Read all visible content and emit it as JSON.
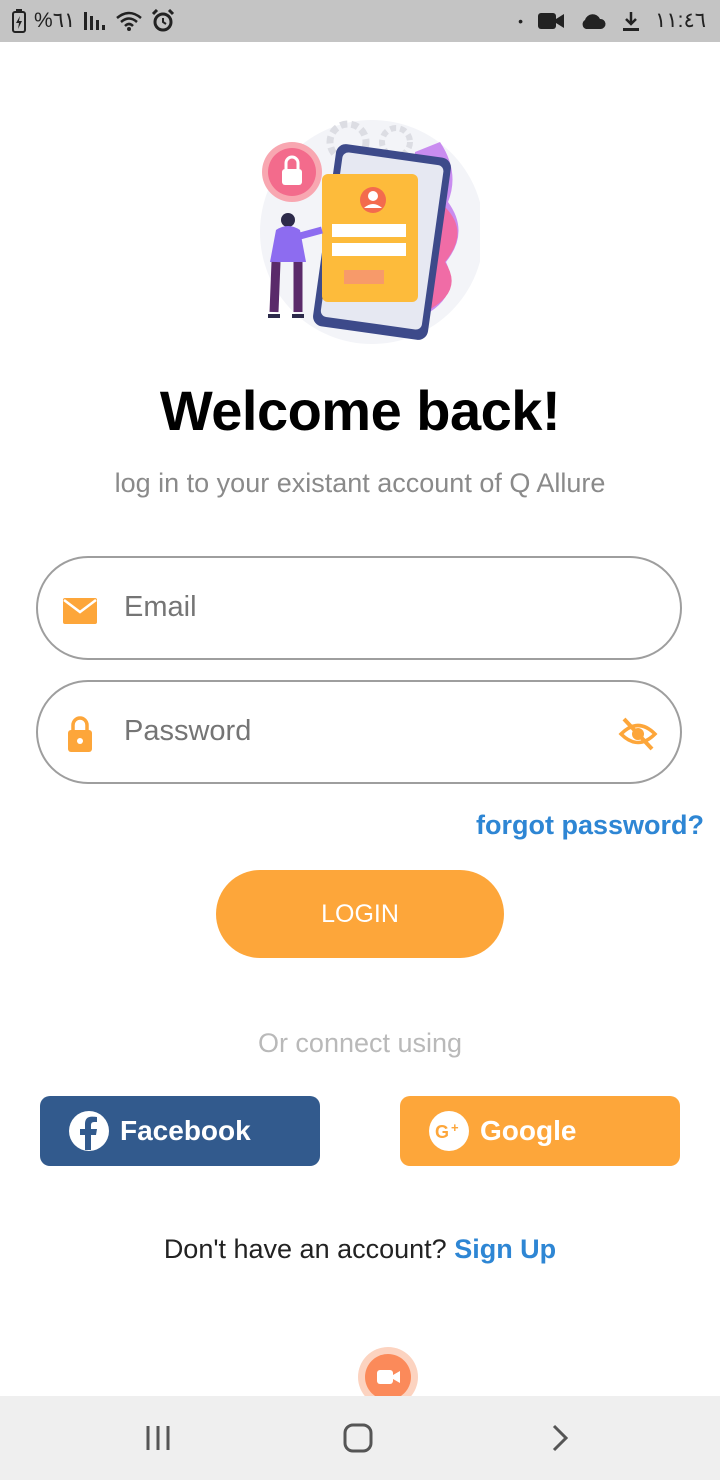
{
  "status_bar": {
    "battery_text": "%٦١",
    "time": "١١:٤٦"
  },
  "header": {
    "title": "Welcome back!",
    "subtitle": "log in to your existant account of Q Allure"
  },
  "form": {
    "email_placeholder": "Email",
    "password_placeholder": "Password",
    "forgot_label": "forgot password?",
    "login_label": "LOGIN"
  },
  "social": {
    "connect_label": "Or connect using",
    "facebook_label": "Facebook",
    "google_label": "Google"
  },
  "footer": {
    "prompt": "Don't have an account?",
    "signup_label": "Sign Up"
  },
  "colors": {
    "accent": "#fda63a",
    "link": "#2e86d4",
    "facebook": "#325a8d"
  },
  "icons": {
    "email": "envelope-icon",
    "password": "lock-icon",
    "visibility": "eye-off-icon",
    "facebook": "facebook-icon",
    "google": "google-plus-icon"
  }
}
